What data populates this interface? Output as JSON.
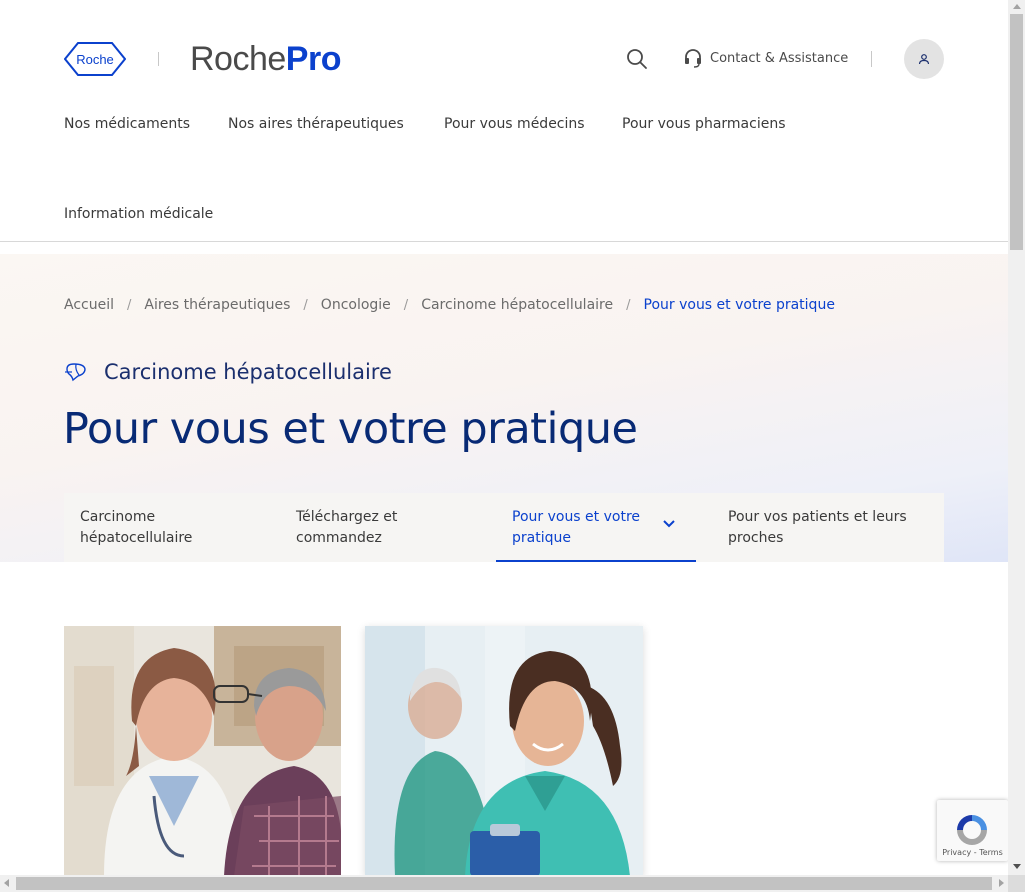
{
  "header": {
    "logo_text": "Roche",
    "brand_primary": "Roche",
    "brand_secondary": "Pro",
    "contact_label": "Contact & Assistance",
    "icons": [
      "search-icon",
      "headset-icon",
      "user-icon"
    ]
  },
  "nav": {
    "items": [
      {
        "label": "Nos médicaments"
      },
      {
        "label": "Nos aires thérapeutiques"
      },
      {
        "label": "Pour vous médecins"
      },
      {
        "label": "Pour vous pharmaciens"
      },
      {
        "label": "Information médicale"
      }
    ]
  },
  "breadcrumb": {
    "items": [
      "Accueil",
      "Aires thérapeutiques",
      "Oncologie",
      "Carcinome hépatocellulaire"
    ],
    "separator": "/",
    "current": "Pour vous et votre pratique"
  },
  "hero": {
    "subtitle": "Carcinome hépatocellulaire",
    "subtitle_icon": "liver-icon",
    "title": "Pour vous et votre pratique"
  },
  "tabs": [
    {
      "label": "Carcinome hépatocellulaire",
      "active": false
    },
    {
      "label": "Téléchargez et commandez",
      "active": false
    },
    {
      "label": "Pour vous et votre pratique",
      "active": true
    },
    {
      "label": "Pour vos patients et leurs proches",
      "active": false
    }
  ],
  "recaptcha": {
    "privacy": "Privacy",
    "terms": "Terms",
    "sep": " - "
  },
  "colors": {
    "brand_blue": "#0b41cd",
    "title_navy": "#082a75"
  }
}
